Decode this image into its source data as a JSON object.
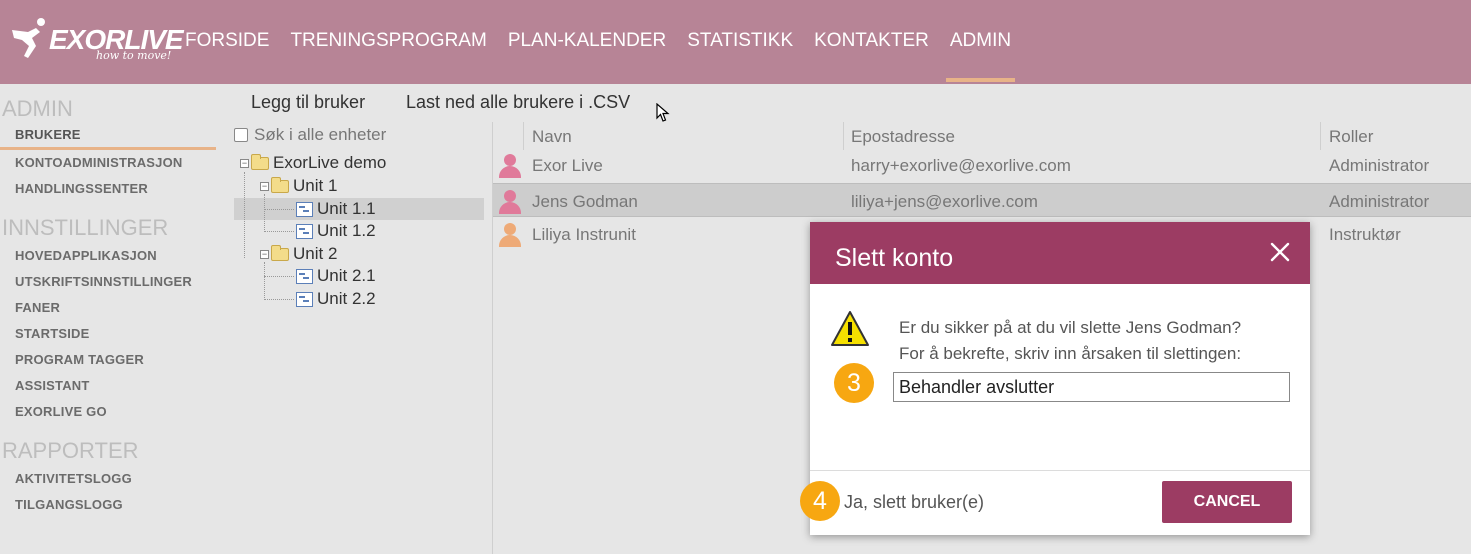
{
  "header": {
    "logo_text": "EXORLIVE",
    "logo_tagline": "how to move!",
    "nav": [
      "FORSIDE",
      "TRENINGSPROGRAM",
      "PLAN-KALENDER",
      "STATISTIKK",
      "KONTAKTER",
      "ADMIN"
    ],
    "active_nav": "ADMIN",
    "accent_color": "#e8b388",
    "bg_color": "#b78496"
  },
  "sidebar": {
    "sections": [
      {
        "title": "ADMIN",
        "items": [
          "BRUKERE",
          "KONTOADMINISTRASJON",
          "HANDLINGSSENTER"
        ]
      },
      {
        "title": "INNSTILLINGER",
        "items": [
          "HOVEDAPPLIKASJON",
          "UTSKRIFTSINNSTILLINGER",
          "FANER",
          "STARTSIDE",
          "PROGRAM TAGGER",
          "ASSISTANT",
          "EXORLIVE GO"
        ]
      },
      {
        "title": "RAPPORTER",
        "items": [
          "AKTIVITETSLOGG",
          "TILGANGSLOGG"
        ]
      }
    ],
    "active_item": "BRUKERE"
  },
  "toolbar": {
    "add_user": "Legg til bruker",
    "download_csv": "Last ned alle brukere i .CSV"
  },
  "tree": {
    "search_label": "Søk i alle enheter",
    "root": "ExorLive demo",
    "unit1": "Unit 1",
    "unit1_1": "Unit 1.1",
    "unit1_2": "Unit 1.2",
    "unit2": "Unit 2",
    "unit2_1": "Unit 2.1",
    "unit2_2": "Unit 2.2",
    "selected": "Unit 1.1"
  },
  "grid": {
    "columns": [
      "Navn",
      "Epostadresse",
      "Roller"
    ],
    "rows": [
      {
        "name": "Exor Live",
        "email": "harry+exorlive@exorlive.com",
        "role": "Administrator",
        "avatar_color": "#e07a9a"
      },
      {
        "name": "Jens Godman",
        "email": "liliya+jens@exorlive.com",
        "role": "Administrator",
        "avatar_color": "#e07a9a"
      },
      {
        "name": "Liliya Instrunit",
        "email": "",
        "role": "Instruktør",
        "avatar_color": "#eeaa77"
      }
    ],
    "selected_row": "Jens Godman"
  },
  "modal": {
    "title": "Slett konto",
    "question": "Er du sikker på at du vil slette Jens Godman?",
    "confirm_prompt": "For å bekrefte, skriv inn årsaken til slettingen:",
    "reason_value": "Behandler avslutter",
    "step3": "3",
    "step4": "4",
    "yes_label": "Ja, slett bruker(e)",
    "cancel_label": "CANCEL",
    "accent_color": "#9c3c63",
    "step_color": "#f7a711"
  }
}
